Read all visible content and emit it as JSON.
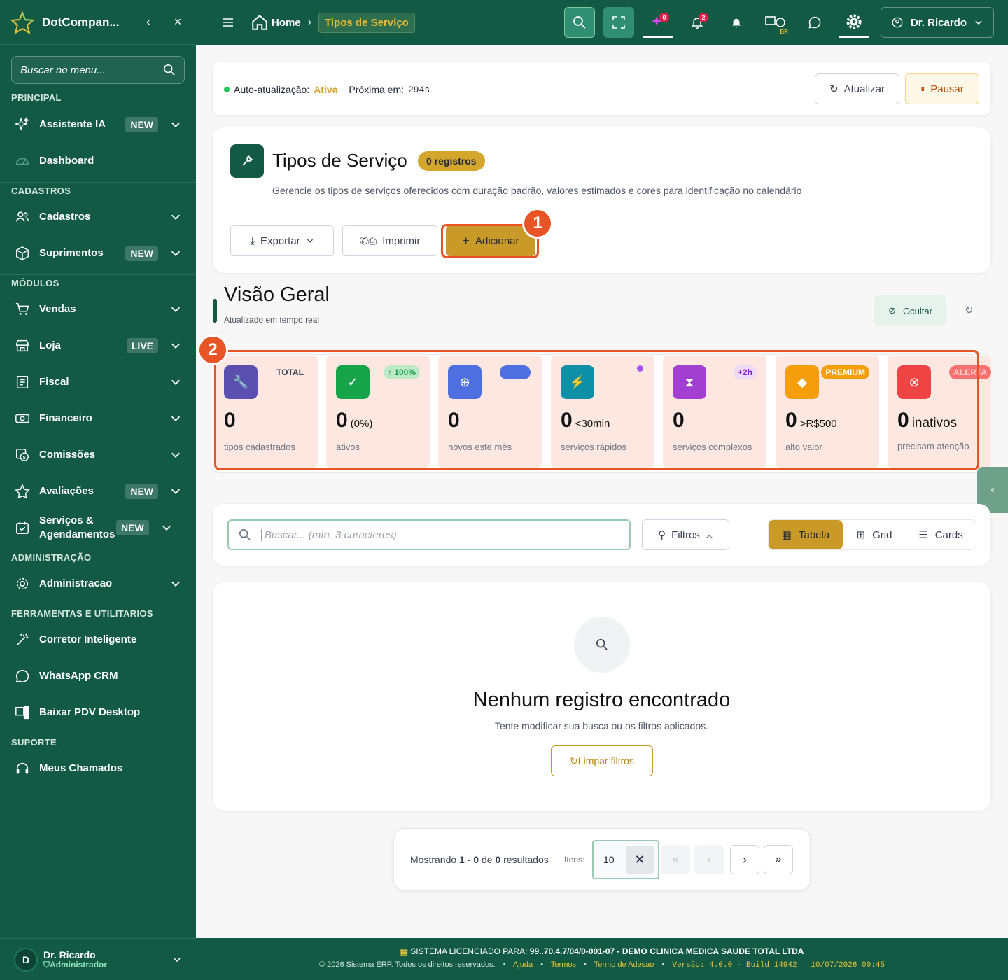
{
  "sidebar": {
    "brand": "DotCompan...",
    "search_placeholder": "Buscar no menu...",
    "sections": {
      "principal": "PRINCIPAL",
      "cadastros": "CADASTROS",
      "modulos": "MÓDULOS",
      "administracao": "ADMINISTRAÇÃO",
      "ferramentas": "FERRAMENTAS E UTILITARIOS",
      "suporte": "SUPORTE"
    },
    "items": {
      "assistente": {
        "label": "Assistente IA",
        "badge": "NEW"
      },
      "dashboard": {
        "label": "Dashboard"
      },
      "cadastros": {
        "label": "Cadastros"
      },
      "suprimentos": {
        "label": "Suprimentos",
        "badge": "NEW"
      },
      "vendas": {
        "label": "Vendas"
      },
      "loja": {
        "label": "Loja",
        "badge": "LIVE"
      },
      "fiscal": {
        "label": "Fiscal"
      },
      "financeiro": {
        "label": "Financeiro"
      },
      "comissoes": {
        "label": "Comissões"
      },
      "avaliacoes": {
        "label": "Avaliações",
        "badge": "NEW"
      },
      "servicos": {
        "label": "Serviços & Agendamentos",
        "badge": "NEW"
      },
      "administracao": {
        "label": "Administracao"
      },
      "corretor": {
        "label": "Corretor Inteligente"
      },
      "whatsapp": {
        "label": "WhatsApp CRM"
      },
      "pdv": {
        "label": "Baixar PDV Desktop"
      },
      "chamados": {
        "label": "Meus Chamados"
      }
    },
    "user": {
      "initial": "D",
      "name": "Dr. Ricardo",
      "role": "Administrador"
    }
  },
  "topbar": {
    "home": "Home",
    "current": "Tipos de Serviço",
    "notif_ai": "0",
    "notif_bell": "2",
    "lang": "BR",
    "user": "Dr. Ricardo"
  },
  "refresh": {
    "label": "Auto-atualização:",
    "status": "Ativa",
    "next_label": "Próxima em:",
    "next_value": "294s",
    "update_btn": "Atualizar",
    "pause_btn": "Pausar"
  },
  "header": {
    "title": "Tipos de Serviço",
    "count_badge": "0 registros",
    "description": "Gerencie os tipos de serviços oferecidos com duração padrão, valores estimados e cores para identificação no calendário",
    "export_btn": "Exportar",
    "print_btn": "Imprimir",
    "add_btn": "Adicionar"
  },
  "markers": {
    "one": "1",
    "two": "2"
  },
  "overview": {
    "title": "Visão Geral",
    "subtitle": "Atualizado em tempo real",
    "hide_btn": "Ocultar",
    "kpis": [
      {
        "value": "0",
        "suffix": "",
        "label": "tipos cadastrados",
        "tag": "TOTAL",
        "color": "#5b4fb0"
      },
      {
        "value": "0",
        "suffix": "(0%)",
        "label": "ativos",
        "tag": "↑ 100%",
        "color": "#16a34a"
      },
      {
        "value": "0",
        "suffix": "",
        "label": "novos este mês",
        "tag": "",
        "color": "#4f6ee0"
      },
      {
        "value": "0",
        "suffix": "<30min",
        "label": "serviços rápidos",
        "tag": "",
        "color": "#0e8fa8"
      },
      {
        "value": "0",
        "suffix": "",
        "label": "serviços complexos",
        "tag": "+2h",
        "color": "#a23fd1"
      },
      {
        "value": "0",
        "suffix": ">R$500",
        "label": "alto valor",
        "tag": "PREMIUM",
        "color": "#f59e0b"
      },
      {
        "value": "0",
        "suffix": "inativos",
        "label": "precisam atenção",
        "tag": "ALERTA",
        "color": "#ef4444"
      }
    ]
  },
  "filters": {
    "search_placeholder": "Buscar... (mín. 3 caracteres)",
    "filters_btn": "Filtros",
    "views": [
      "Tabela",
      "Grid",
      "Cards"
    ]
  },
  "empty": {
    "title": "Nenhum registro encontrado",
    "subtitle": "Tente modificar sua busca ou os filtros aplicados.",
    "clear_btn": "Limpar filtros"
  },
  "pagination": {
    "showing": "Mostrando",
    "from": "1",
    "sep": "-",
    "to": "0",
    "of": "de",
    "total": "0",
    "results": "resultados",
    "items_label": "Itens:",
    "page_size": "10"
  },
  "footer": {
    "license_label": "SISTEMA LICENCIADO PARA:",
    "license_value": "99..70.4.7/04/0-001-07 - DEMO CLINICA MEDICA SAUDE TOTAL LTDA",
    "copyright": "© 2026 Sistema ERP. Todos os direitos reservados.",
    "links": [
      "Ajuda",
      "Termos",
      "Termo de Adesao"
    ],
    "version": "Versão: 4.0.0 - Build 14942 | 10/07/2026 00:45"
  }
}
